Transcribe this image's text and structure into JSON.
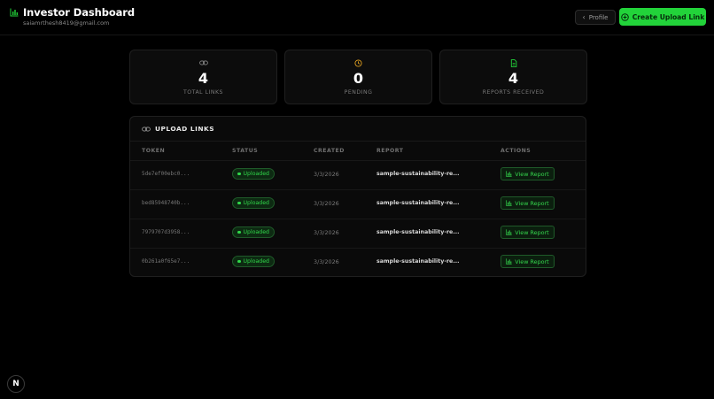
{
  "header": {
    "title": "Investor Dashboard",
    "email": "saiamrthesh8419@gmail.com",
    "profile_label": "Profile",
    "create_label": "Create Upload Link"
  },
  "stats": [
    {
      "value": "4",
      "label": "TOTAL LINKS",
      "icon": "link-icon"
    },
    {
      "value": "0",
      "label": "PENDING",
      "icon": "clock-icon"
    },
    {
      "value": "4",
      "label": "REPORTS RECEIVED",
      "icon": "file-icon"
    }
  ],
  "table": {
    "title": "UPLOAD LINKS",
    "headers": {
      "token": "TOKEN",
      "status": "STATUS",
      "created": "CREATED",
      "report": "REPORT",
      "actions": "ACTIONS"
    },
    "rows": [
      {
        "token": "5de7ef00ebc0...",
        "status": "Uploaded",
        "created": "3/3/2026",
        "report": "sample-sustainability-re...",
        "action": "View Report"
      },
      {
        "token": "bed85948740b...",
        "status": "Uploaded",
        "created": "3/3/2026",
        "report": "sample-sustainability-re...",
        "action": "View Report"
      },
      {
        "token": "7979707d3958...",
        "status": "Uploaded",
        "created": "3/3/2026",
        "report": "sample-sustainability-re...",
        "action": "View Report"
      },
      {
        "token": "0b261a0f65e7...",
        "status": "Uploaded",
        "created": "3/3/2026",
        "report": "sample-sustainability-re...",
        "action": "View Report"
      }
    ]
  },
  "devtools_badge": "N",
  "colors": {
    "accent": "#22d33a",
    "background": "#000000",
    "card": "#0c0c0c"
  }
}
